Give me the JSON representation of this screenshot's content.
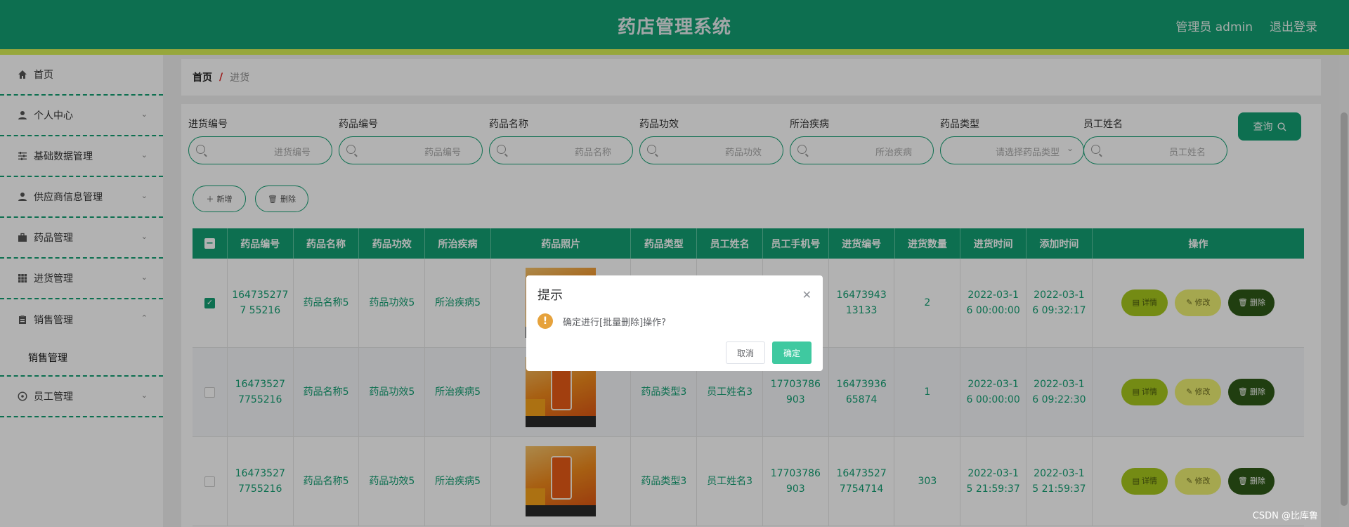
{
  "header": {
    "title": "药店管理系统",
    "user": "管理员 admin",
    "logout": "退出登录"
  },
  "sidebar": {
    "items": [
      {
        "label": "首页",
        "icon": "home-icon",
        "chevron": ""
      },
      {
        "label": "个人中心",
        "icon": "user-icon",
        "chevron": "⌄"
      },
      {
        "label": "基础数据管理",
        "icon": "sliders-icon",
        "chevron": "⌄"
      },
      {
        "label": "供应商信息管理",
        "icon": "user-icon",
        "chevron": "⌄"
      },
      {
        "label": "药品管理",
        "icon": "briefcase-icon",
        "chevron": "⌄"
      },
      {
        "label": "进货管理",
        "icon": "grid-icon",
        "chevron": "⌄"
      },
      {
        "label": "销售管理",
        "icon": "clipboard-icon",
        "chevron": "⌃"
      },
      {
        "label": "员工管理",
        "icon": "compass-icon",
        "chevron": "⌄"
      }
    ],
    "submenu": "销售管理"
  },
  "breadcrumb": {
    "home": "首页",
    "sep": "/",
    "current": "进货"
  },
  "filters": [
    {
      "label": "进货编号",
      "placeholder": "进货编号"
    },
    {
      "label": "药品编号",
      "placeholder": "药品编号"
    },
    {
      "label": "药品名称",
      "placeholder": "药品名称"
    },
    {
      "label": "药品功效",
      "placeholder": "药品功效"
    },
    {
      "label": "所治疾病",
      "placeholder": "所治疾病"
    },
    {
      "label": "药品类型",
      "placeholder": "请选择药品类型"
    },
    {
      "label": "员工姓名",
      "placeholder": "员工姓名"
    }
  ],
  "buttons": {
    "query": "查询",
    "add": "新增",
    "delete": "删除"
  },
  "table": {
    "headers": [
      "药品编号",
      "药品名称",
      "药品功效",
      "所治疾病",
      "药品照片",
      "药品类型",
      "员工姓名",
      "员工手机号",
      "进货编号",
      "进货数量",
      "进货时间",
      "添加时间",
      "操作"
    ],
    "rows": [
      {
        "checked": true,
        "cells": [
          "1647352777 55216",
          "药品名称5",
          "药品功效5",
          "所治疾病5",
          "",
          "",
          "",
          "",
          "16473943 13133",
          "2",
          "2022-03-1 6 00:00:00",
          "2022-03-1 6 09:32:17"
        ]
      },
      {
        "checked": false,
        "cells": [
          "16473527 7755216",
          "药品名称5",
          "药品功效5",
          "所治疾病5",
          "",
          "药品类型3",
          "员工姓名3",
          "17703786 903",
          "16473936 65874",
          "1",
          "2022-03-1 6 00:00:00",
          "2022-03-1 6 09:22:30"
        ]
      },
      {
        "checked": false,
        "cells": [
          "16473527 7755216",
          "药品名称5",
          "药品功效5",
          "所治疾病5",
          "",
          "药品类型3",
          "员工姓名3",
          "17703786 903",
          "16473527 7754714",
          "303",
          "2022-03-1 5 21:59:37",
          "2022-03-1 5 21:59:37"
        ]
      }
    ],
    "ops": {
      "detail": "详情",
      "edit": "修改",
      "del": "删除"
    }
  },
  "dialog": {
    "title": "提示",
    "message": "确定进行[批量删除]操作?",
    "cancel": "取消",
    "ok": "确定"
  },
  "watermark": "CSDN @比库鲁",
  "colors": {
    "primary": "#13a073",
    "strip": "#d9ef57",
    "detail": "#a6c81d",
    "edit": "#ecef72",
    "del": "#2f5a17",
    "warn": "#e6a23c"
  }
}
